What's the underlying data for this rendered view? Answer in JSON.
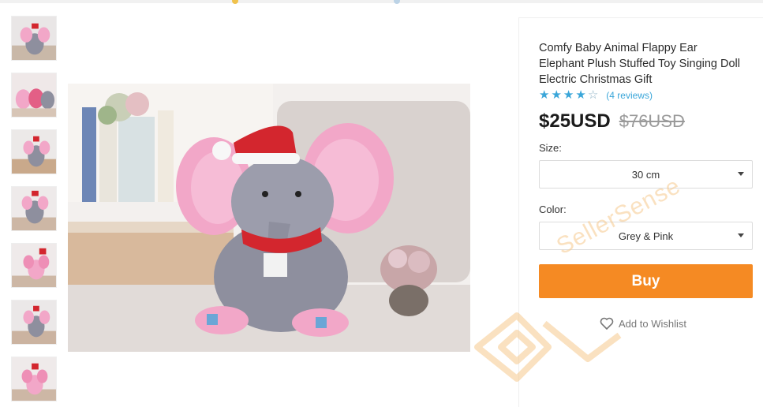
{
  "product": {
    "title": "Comfy Baby Animal Flappy Ear Elephant Plush Stuffed Toy Singing Doll Electric Christmas Gift",
    "rating": {
      "stars_filled": 4,
      "stars_total": 5,
      "reviews_label": "(4 reviews)"
    },
    "price": {
      "current": "$25USD",
      "original": "$76USD"
    }
  },
  "options": {
    "size": {
      "label": "Size:",
      "selected": "30 cm"
    },
    "color": {
      "label": "Color:",
      "selected": "Grey & Pink"
    }
  },
  "actions": {
    "buy_label": "Buy",
    "wishlist_label": "Add to Wishlist"
  },
  "gallery": {
    "thumbnail_count": 7
  },
  "watermark": {
    "text": "SellerSense"
  },
  "colors": {
    "accent": "#f58a23",
    "star": "#3aa6d9",
    "plush_grey": "#8e8f9e",
    "plush_pink": "#f2a7c8"
  },
  "icons": {
    "star": "star-icon",
    "heart": "heart-icon",
    "caret": "chevron-down-icon"
  }
}
